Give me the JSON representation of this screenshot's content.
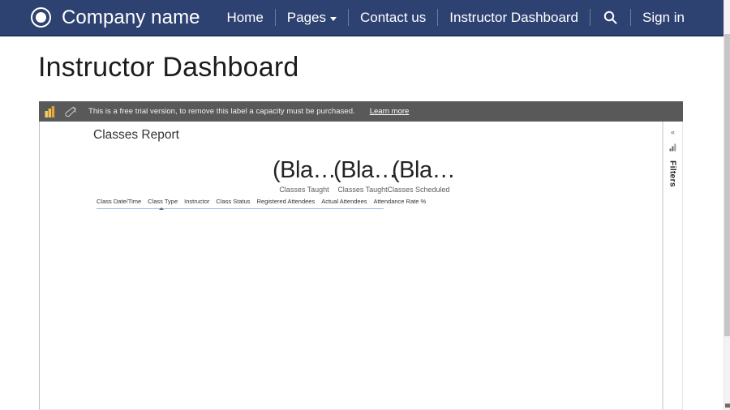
{
  "navbar": {
    "brand": "Company name",
    "logo_icon": "target-circle-icon",
    "links": [
      {
        "label": "Home",
        "icon": null
      },
      {
        "label": "Pages",
        "icon": "chevron-down-icon"
      },
      {
        "label": "Contact us",
        "icon": null
      },
      {
        "label": "Instructor Dashboard",
        "icon": null
      }
    ],
    "search_icon": "search-icon",
    "signin": "Sign in",
    "background": "#2e4272"
  },
  "page": {
    "title": "Instructor Dashboard"
  },
  "trial_banner": {
    "powerbi_icon": "power-bi-logo-icon",
    "capacity_icon": "capacity-brush-icon",
    "text": "This is a free trial version, to remove this label a capacity must be purchased.",
    "link": "Learn more",
    "background": "#595959"
  },
  "report": {
    "title": "Classes Report",
    "kpis": [
      {
        "value": "(Bla…",
        "label": "Classes Taught"
      },
      {
        "value": "(Bla…",
        "label": "Classes Taught"
      },
      {
        "value": "(Bla…",
        "label": "Classes Scheduled"
      }
    ],
    "table_headers": [
      "Class Date/Time",
      "Class Type",
      "Instructor",
      "Class Status",
      "Registered Attendees",
      "Actual Attendees",
      "Attendance Rate %"
    ],
    "sorted_column_index": 1
  },
  "filters_pane": {
    "expand_icon": "chevron-double-left-icon",
    "filter_icon": "filter-icon",
    "label": "Filters"
  }
}
